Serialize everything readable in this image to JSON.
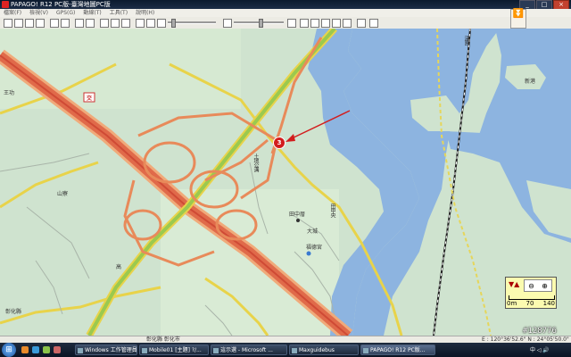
{
  "window": {
    "title": "PAPAGO! R12 PC版-臺灣地圖PC版"
  },
  "window_buttons": [
    "_",
    "□",
    "×"
  ],
  "menu": [
    "檔案(F)",
    "檢視(V)",
    "GPS(G)",
    "動線(T)",
    "工具(T)",
    "說明(H)"
  ],
  "nav_arrow": "⏬",
  "map": {
    "labels": {
      "lbl1": "王功",
      "lbl2": "山寮",
      "lbl3": "田中厝",
      "lbl4": "大城",
      "lbl5": "福德宮",
      "lbl6": "田中央",
      "lbl7": "土地公溝",
      "lbl8": "新港",
      "lbl9": "彰化縣",
      "lbl10": "高",
      "lbl11": "漢寶"
    },
    "highway_shield": "3",
    "markers": {
      "interchange": "交"
    }
  },
  "scale": {
    "direction": "▼▲",
    "zoom_out": "⊖",
    "zoom_in": "⊕",
    "ticks": [
      "0m",
      "70",
      "140"
    ]
  },
  "watermark": "#128776",
  "status": {
    "area": "彰化縣 彰化市",
    "coord": "E : 120°36'52.6\"  N : 24°05'50.0\""
  },
  "taskbar": {
    "start": "⊞",
    "tasks": [
      "Windows 工作管理員",
      "Mobile01 [主題] ?/...",
      "這示選 - Microsoft ...",
      "Maxguidebus",
      "PAPAGO! R12 PC版..."
    ],
    "tray": "中 ◁ 🔊"
  },
  "colors": {
    "water": "#8db4e0",
    "land": "#cfe3cf",
    "highway": "#e06a4a",
    "road": "#f2dd6a"
  }
}
